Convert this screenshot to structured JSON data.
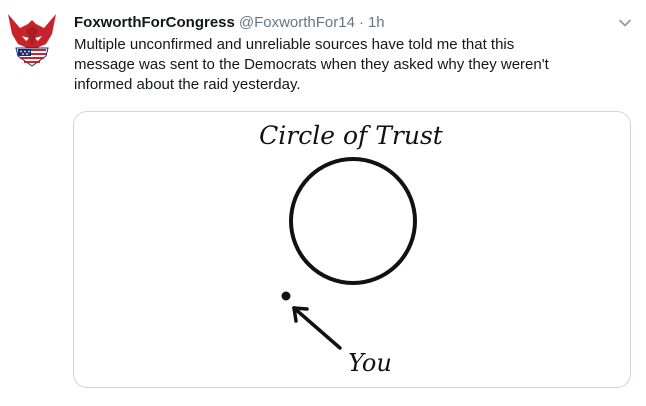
{
  "tweet": {
    "display_name": "FoxworthForCongress",
    "handle": "@FoxworthFor14",
    "separator": "·",
    "timestamp": "1h",
    "text_lines": [
      "Multiple unconfirmed and unreliable sources have told me that this",
      "message was sent to the Democrats when they asked why they weren't",
      "informed about the raid yesterday."
    ],
    "avatar_icon": "fox-logo-icon",
    "menu_icon": "chevron-down-icon"
  },
  "media": {
    "heading": "Circle of Trust",
    "pointer_label": "You"
  },
  "colors": {
    "text": "#14171a",
    "secondary_text": "#657786",
    "border": "#ccd6dd",
    "avatar_red": "#c8232c",
    "avatar_blue": "#1e2a6e"
  }
}
